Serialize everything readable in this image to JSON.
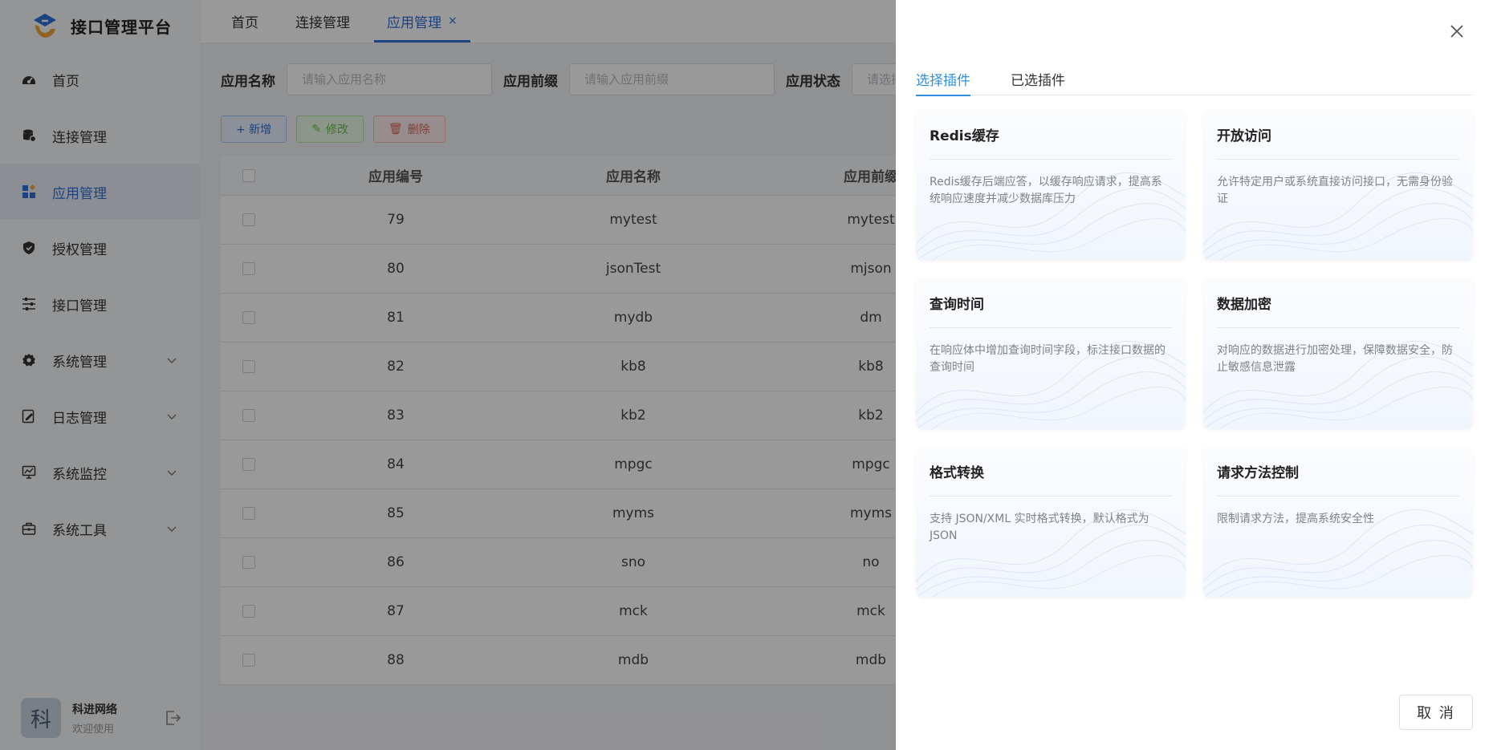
{
  "app": {
    "title": "接口管理平台"
  },
  "sidebar": {
    "items": [
      {
        "label": "首页",
        "icon": "dashboard-icon"
      },
      {
        "label": "连接管理",
        "icon": "database-icon"
      },
      {
        "label": "应用管理",
        "icon": "apps-icon",
        "active": true
      },
      {
        "label": "授权管理",
        "icon": "shield-icon"
      },
      {
        "label": "接口管理",
        "icon": "sliders-icon"
      },
      {
        "label": "系统管理",
        "icon": "gear-icon",
        "expandable": true
      },
      {
        "label": "日志管理",
        "icon": "edit-log-icon",
        "expandable": true
      },
      {
        "label": "系统监控",
        "icon": "monitor-icon",
        "expandable": true
      },
      {
        "label": "系统工具",
        "icon": "toolbox-icon",
        "expandable": true
      }
    ],
    "user": {
      "avatar": "科",
      "name": "科进网络",
      "sub": "欢迎使用"
    }
  },
  "topbar": {
    "tabs": [
      {
        "label": "首页"
      },
      {
        "label": "连接管理"
      },
      {
        "label": "应用管理",
        "active": true,
        "close": "×"
      }
    ]
  },
  "filters": {
    "app_name_label": "应用名称",
    "app_name_placeholder": "请输入应用名称",
    "app_prefix_label": "应用前缀",
    "app_prefix_placeholder": "请输入应用前缀",
    "app_status_label": "应用状态",
    "app_status_placeholder": "请选择"
  },
  "toolbar": {
    "add_label": "+ 新增",
    "edit_label": "修改",
    "delete_label": "删除"
  },
  "table": {
    "headers": [
      "应用编号",
      "应用名称",
      "应用前缀"
    ],
    "rows": [
      [
        "79",
        "mytest",
        "mytest"
      ],
      [
        "80",
        "jsonTest",
        "mjson"
      ],
      [
        "81",
        "mydb",
        "dm"
      ],
      [
        "82",
        "kb8",
        "kb8"
      ],
      [
        "83",
        "kb2",
        "kb2"
      ],
      [
        "84",
        "mpgc",
        "mpgc"
      ],
      [
        "85",
        "myms",
        "myms"
      ],
      [
        "86",
        "sno",
        "no"
      ],
      [
        "87",
        "mck",
        "mck"
      ],
      [
        "88",
        "mdb",
        "mdb"
      ]
    ]
  },
  "drawer": {
    "tabs": [
      {
        "label": "选择插件",
        "active": true
      },
      {
        "label": "已选插件"
      }
    ],
    "plugins": [
      {
        "title": "Redis缓存",
        "desc": "Redis缓存后端应答，以缓存响应请求，提高系统响应速度并减少数据库压力"
      },
      {
        "title": "开放访问",
        "desc": "允许特定用户或系统直接访问接口，无需身份验证"
      },
      {
        "title": "查询时间",
        "desc": "在响应体中增加查询时间字段，标注接口数据的查询时间"
      },
      {
        "title": "数据加密",
        "desc": "对响应的数据进行加密处理，保障数据安全，防止敏感信息泄露"
      },
      {
        "title": "格式转换",
        "desc": "支持 JSON/XML 实时格式转换，默认格式为 JSON"
      },
      {
        "title": "请求方法控制",
        "desc": "限制请求方法，提高系统安全性"
      }
    ],
    "cancel_label": "取 消"
  },
  "colors": {
    "accent": "#2f6fd8",
    "tab_accent": "#2f8ee0",
    "mask": "rgba(0,0,0,0.4)"
  }
}
